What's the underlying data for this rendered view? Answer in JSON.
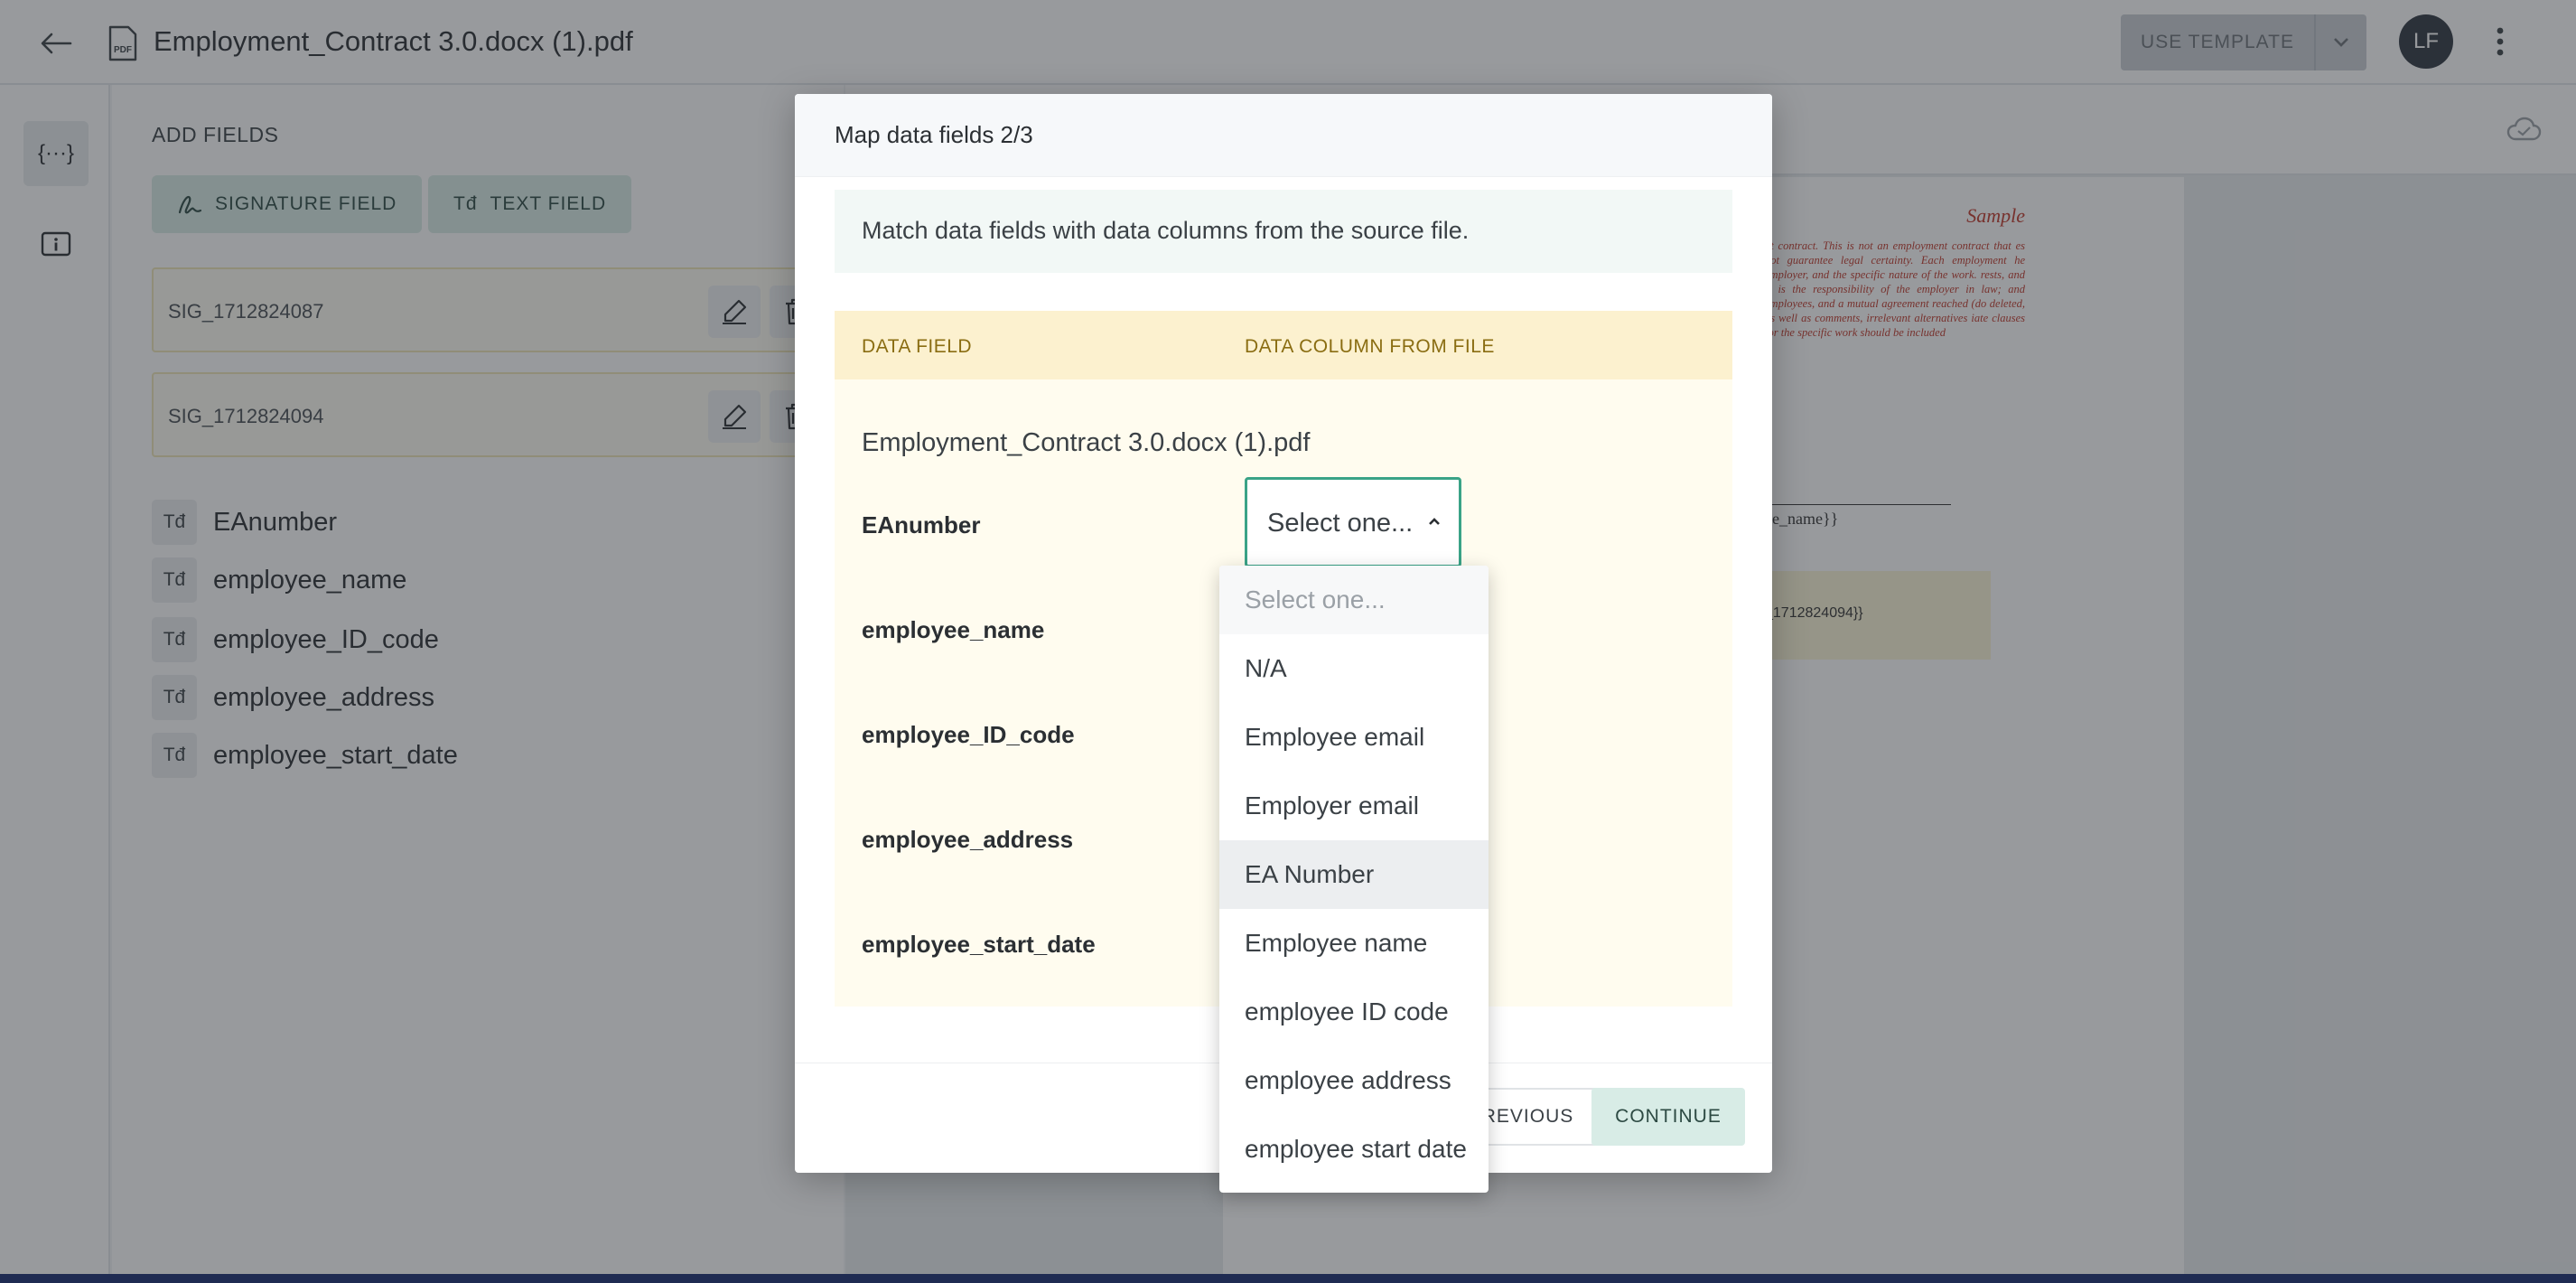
{
  "topbar": {
    "title": "Employment_Contract 3.0.docx (1).pdf",
    "use_template_label": "USE TEMPLATE",
    "avatar_initials": "LF"
  },
  "rail": {
    "fields_icon_glyph": "{···}",
    "info_icon_glyph": "i"
  },
  "panel": {
    "title": "ADD FIELDS",
    "signature_field_label": "SIGNATURE FIELD",
    "text_field_label": "TEXT FIELD",
    "text_field_glyph": "Tđ",
    "signatures": [
      {
        "label": "SIG_1712824087"
      },
      {
        "label": "SIG_1712824094"
      }
    ],
    "fields": [
      {
        "label": "EAnumber"
      },
      {
        "label": "employee_name"
      },
      {
        "label": "employee_ID_code"
      },
      {
        "label": "employee_address"
      },
      {
        "label": "employee_start_date"
      }
    ]
  },
  "document": {
    "sample_label": "Sample",
    "red_text": "nt contract. This is not an employment contract that es not guarantee legal certainty. Each employment he employer, and the specific nature of the work. rests, and it is the responsibility of the employer in law; and employees, and a mutual agreement reached (do deleted, as well as comments, irrelevant alternatives iate clauses for the specific work should be included",
    "placeholder_name": "ee_name}}",
    "placeholder_sig": "_1712824094}}"
  },
  "modal": {
    "title": "Map data fields 2/3",
    "info_text": "Match data fields with data columns from the source file.",
    "col_data_field": "DATA FIELD",
    "col_data_column": "DATA COLUMN FROM FILE",
    "file_name": "Employment_Contract 3.0.docx (1).pdf",
    "rows": [
      {
        "label": "EAnumber"
      },
      {
        "label": "employee_name"
      },
      {
        "label": "employee_ID_code"
      },
      {
        "label": "employee_address"
      },
      {
        "label": "employee_start_date"
      }
    ],
    "select_value": "Select one...",
    "previous_label": "PREVIOUS",
    "continue_label": "CONTINUE"
  },
  "dropdown": {
    "options": [
      {
        "label": "Select one..."
      },
      {
        "label": "N/A"
      },
      {
        "label": "Employee email"
      },
      {
        "label": "Employer email"
      },
      {
        "label": "EA Number"
      },
      {
        "label": "Employee name"
      },
      {
        "label": "employee ID code"
      },
      {
        "label": "employee address"
      },
      {
        "label": "employee start date"
      }
    ]
  },
  "colors": {
    "accent": "#3aa387",
    "button_bg": "#d8ece6",
    "table_bg": "#fffcef",
    "table_header_bg": "#fcf1cf",
    "avatar_bg": "#2f3640"
  }
}
